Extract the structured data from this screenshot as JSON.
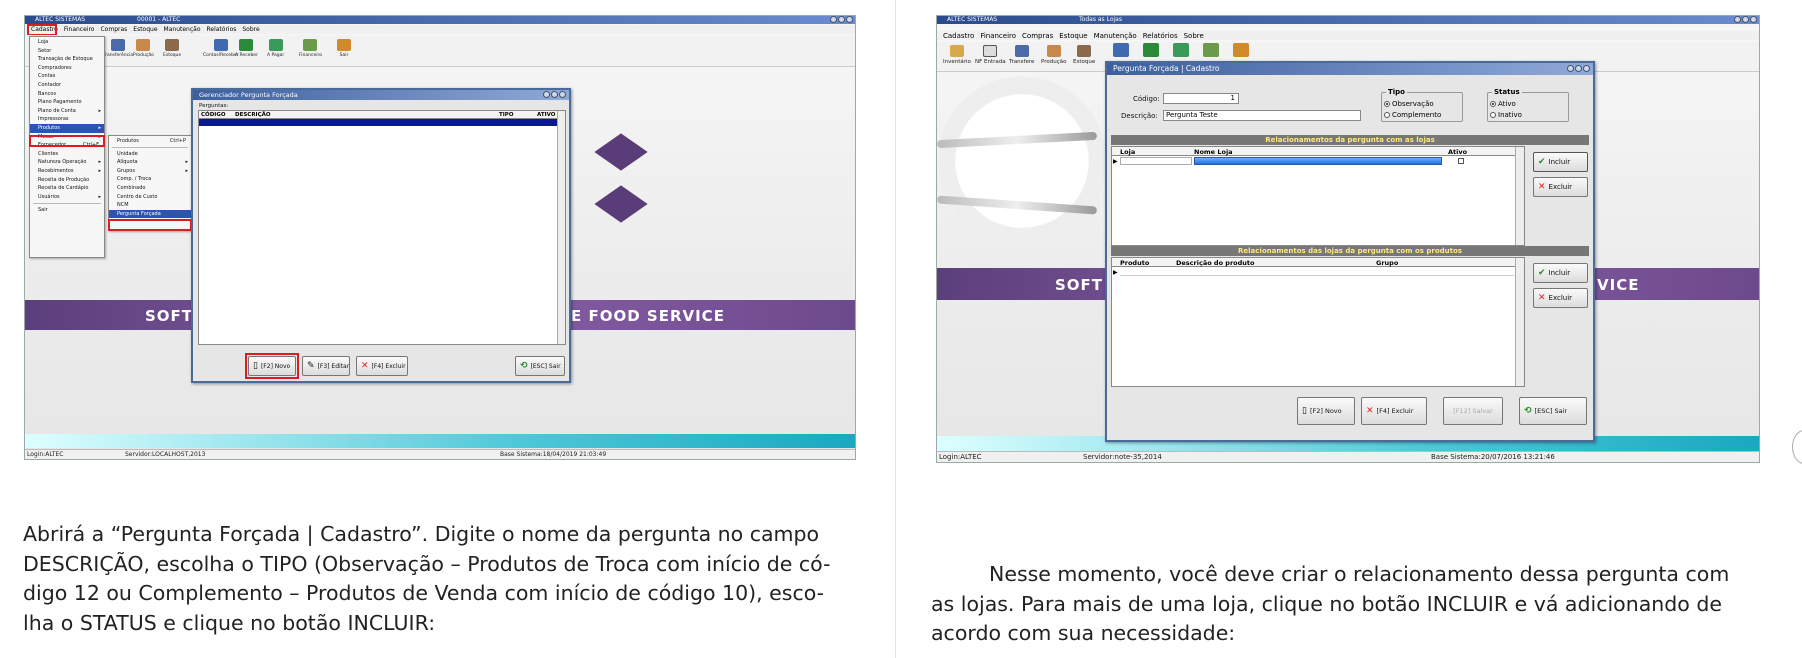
{
  "left_screenshot": {
    "title": "ALTEC SISTEMAS",
    "code": "00001 - ALTEC",
    "menu": [
      "Cadastro",
      "Financeiro",
      "Compras",
      "Estoque",
      "Manutenção",
      "Relatórios",
      "Sobre"
    ],
    "toolbar": [
      "Transferência",
      "Produção",
      "Estoque",
      "Contas/Receber",
      "A Receber",
      "A Pagar",
      "Financeiro",
      "Sair"
    ],
    "cadastro_menu": [
      "Loja",
      "Setor",
      "Transação de Estoque",
      "Compradores",
      "Contas",
      "Contador",
      "Bancos",
      "Plano Pagamento",
      "Plano de Conta",
      "Impressoras",
      "Produtos",
      "Mesas",
      "Fornecedor",
      "Clientes",
      "Natureza Operação",
      "Recebimentos",
      "Receita de Produção",
      "Receita de Cardápio",
      "Usuários",
      "Sair"
    ],
    "fornecedor_shortcut": "Ctrl+F",
    "produtos_menu": [
      "Produtos",
      "Unidade",
      "Alíquota",
      "Grupos",
      "Comp. / Troca",
      "Combinado",
      "Centro de Custo",
      "NCM",
      "Pergunta Forçada"
    ],
    "produtos_shortcut": "Ctrl+P",
    "dialog": {
      "title": "Gerenciador Pergunta Forçada",
      "grid_label": "Perguntas:",
      "columns": [
        "CÓDIGO",
        "DESCRIÇÃO",
        "TIPO",
        "ATIVO"
      ],
      "buttons": [
        "[F2] Novo",
        "[F3] Editar",
        "[F4] Excluir",
        "[ESC] Sair"
      ]
    },
    "banner_left": "SOFT",
    "banner_right": "E FOOD SERVICE",
    "status": {
      "login": "Login:ALTEC",
      "server": "Servidor:LOCALHOST,2013",
      "base": "Base Sistema:18/04/2019 21:03:49"
    }
  },
  "right_screenshot": {
    "title": "ALTEC SISTEMAS",
    "store": "Todas as Lojas",
    "menu": [
      "Cadastro",
      "Financeiro",
      "Compras",
      "Estoque",
      "Manutenção",
      "Relatórios",
      "Sobre"
    ],
    "toolbar": [
      "Inventário",
      "NF Entrada",
      "Transfere",
      "Produção",
      "Estoque"
    ],
    "dialog": {
      "title": "Pergunta Forçada | Cadastro",
      "codigo_label": "Código:",
      "codigo_value": "1",
      "descricao_label": "Descrição:",
      "descricao_value": "Pergunta Teste",
      "tipo_label": "Tipo",
      "tipo_options": [
        "Observação",
        "Complemento"
      ],
      "tipo_selected": "Observação",
      "status_label": "Status",
      "status_options": [
        "Ativo",
        "Inativo"
      ],
      "status_selected": "Ativo",
      "section1": "Relacionamentos da pergunta com as lojas",
      "section1_columns": [
        "Loja",
        "Nome Loja",
        "Ativo"
      ],
      "section2": "Relacionamentos das lojas da pergunta com os produtos",
      "section2_columns": [
        "Produto",
        "Descrição do produto",
        "Grupo"
      ],
      "incluir": "Incluir",
      "excluir": "Excluir",
      "buttons": [
        "[F2] Novo",
        "[F4] Excluir",
        "[F12] Salvar",
        "[ESC] Sair"
      ]
    },
    "banner_left": "SOFT",
    "banner_right": "VICE",
    "status": {
      "login": "Login:ALTEC",
      "server": "Servidor:note-35,2014",
      "base": "Base Sistema:20/07/2016 13:21:46"
    }
  },
  "paragraph_left": [
    "Abrirá a “Pergunta Forçada | Cadastro”. Digite o nome da pergunta no campo",
    "DESCRIÇÃO, escolha o TIPO (Observação – Produtos de Troca com início de có-",
    "digo 12 ou Complemento – Produtos de Venda com início de código 10), esco-",
    "lha o STATUS e clique no botão INCLUIR:"
  ],
  "paragraph_right": [
    "Nesse momento, você deve criar o relacionamento dessa pergunta com",
    "as lojas. Para mais de uma loja, clique no botão INCLUIR e vá adicionando de",
    "acordo com sua necessidade:"
  ],
  "colors": {
    "accent_red": "#d81e1e",
    "band_purple": "#6d4a8c",
    "cyan": "#1aa8c0",
    "title_blue": "#2a4b8c"
  }
}
